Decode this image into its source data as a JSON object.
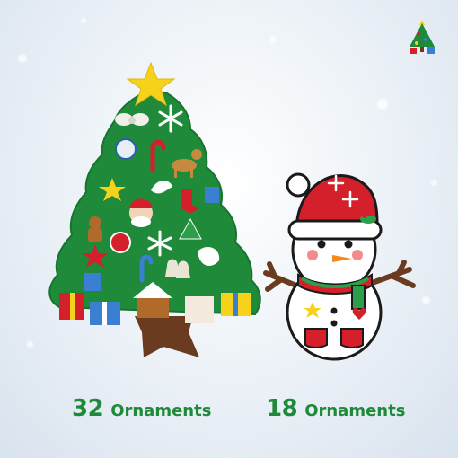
{
  "captions": {
    "tree": {
      "count": "32",
      "label": "Ornaments"
    },
    "snowman": {
      "count": "18",
      "label": "Ornaments"
    }
  },
  "colors": {
    "tree_green": "#1f8a3a",
    "caption_green": "#1f8a3a",
    "hat_red": "#d3202a",
    "trunk_brown": "#6b3b1f",
    "star_yellow": "#f7d21a"
  },
  "icons": [
    "tree-logo-icon",
    "christmas-tree-icon",
    "snowman-icon"
  ]
}
